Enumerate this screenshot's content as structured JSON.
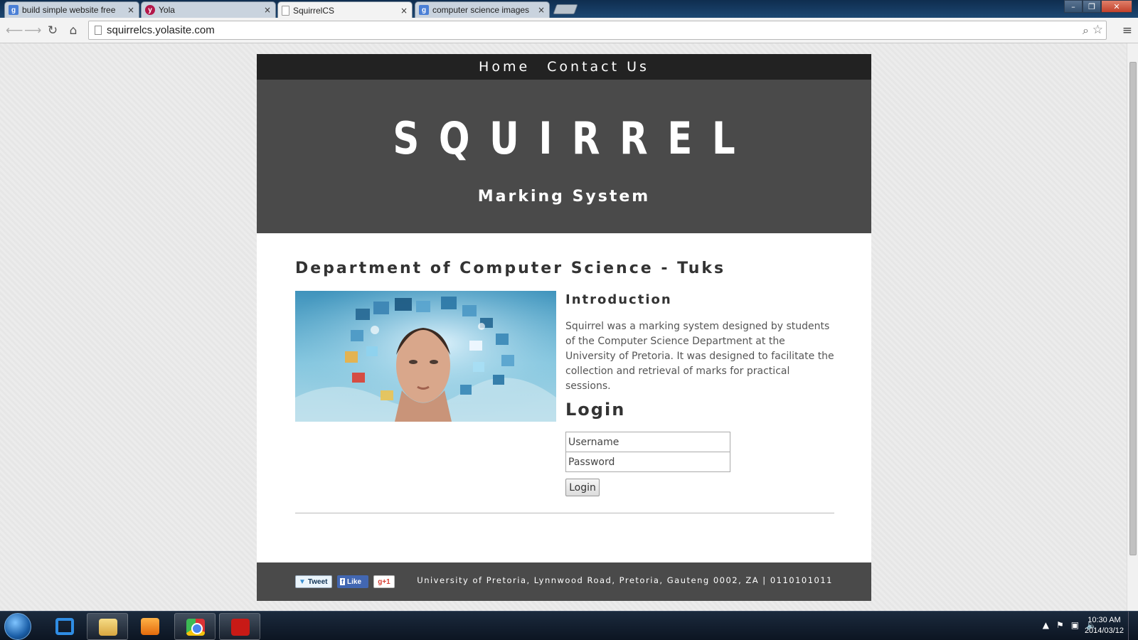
{
  "browser": {
    "tabs": [
      {
        "label": "build simple website free",
        "favicon": "google-icon",
        "active": false
      },
      {
        "label": "Yola",
        "favicon": "yola-icon",
        "active": false
      },
      {
        "label": "SquirrelCS",
        "favicon": "page-icon",
        "active": true
      },
      {
        "label": "computer science images",
        "favicon": "google-icon",
        "active": false
      }
    ],
    "close_glyph": "×",
    "url": "squirrelcs.yolasite.com",
    "window_buttons": {
      "minimize": "–",
      "maximize": "❐",
      "close": "✕"
    }
  },
  "site": {
    "nav": [
      "Home",
      "Contact Us"
    ],
    "logo": "SQUIRREL",
    "tagline": "Marking System",
    "heading": "Department of Computer Science - Tuks",
    "intro": {
      "title": "Introduction",
      "text": "Squirrel was a marking system designed by students of the Computer Science Department at the University of Pretoria. It was designed to facilitate the collection and retrieval of marks for practical sessions."
    },
    "login": {
      "title": "Login",
      "username_placeholder": "Username",
      "password_placeholder": "Password",
      "button": "Login"
    },
    "footer": {
      "share": {
        "tweet": "Tweet",
        "like": "Like",
        "gplus": "g+1"
      },
      "text": "University of Pretoria, Lynnwood Road, Pretoria, Gauteng 0002, ZA | 0110101011"
    }
  },
  "taskbar": {
    "apps": [
      "internet-explorer-icon",
      "file-explorer-icon",
      "media-player-icon",
      "chrome-icon",
      "acrobat-icon"
    ],
    "time": "10:30 AM",
    "date": "2014/03/12"
  },
  "colors": {
    "nav_bg": "#222222",
    "banner_bg": "#4a4a4a",
    "footer_bg": "#4a4a4a",
    "page_bg": "#ffffff"
  }
}
